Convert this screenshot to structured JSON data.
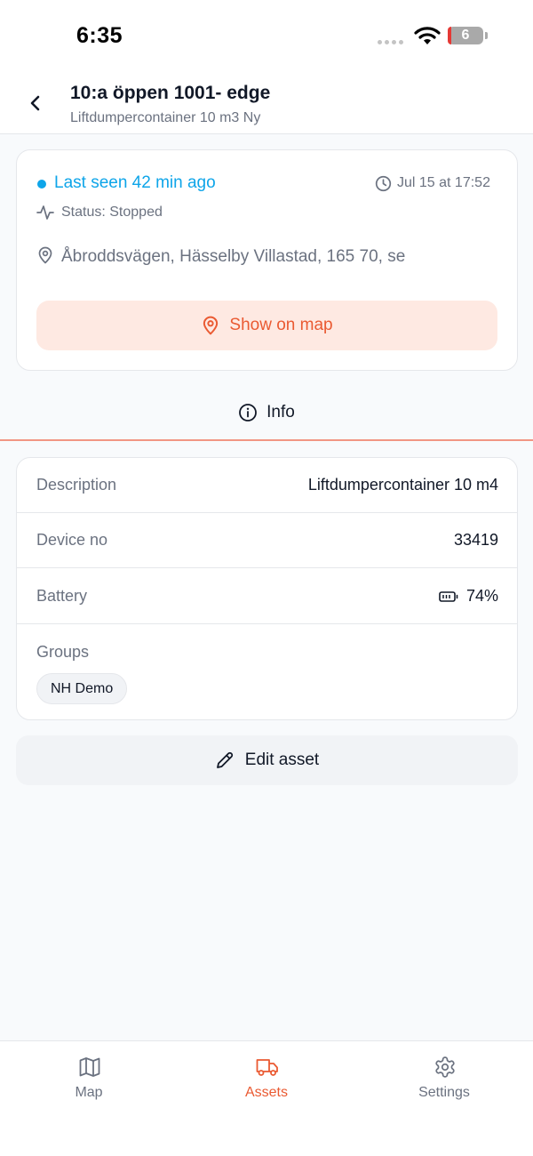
{
  "status_bar": {
    "time": "6:35",
    "battery_level": "6",
    "wifi_icon": "wifi-icon",
    "signal_icon": "cellular-signal-icon"
  },
  "header": {
    "back_icon": "chevron-left-icon",
    "title": "10:a öppen 1001- edge",
    "subtitle": "Liftdumpercontainer 10 m3 Ny"
  },
  "status_card": {
    "last_seen": "Last seen 42 min ago",
    "timestamp": "Jul 15 at 17:52",
    "status": "Status: Stopped",
    "address": "Åbroddsvägen, Hässelby Villastad, 165 70, se",
    "show_on_map_label": "Show on map"
  },
  "tabs": [
    {
      "label": "Info",
      "icon": "info-icon",
      "active": true
    }
  ],
  "info": {
    "rows": [
      {
        "label": "Description",
        "value": "Liftdumpercontainer 10 m4"
      },
      {
        "label": "Device no",
        "value": "33419"
      },
      {
        "label": "Battery",
        "value": "74%"
      }
    ],
    "groups_label": "Groups",
    "groups": [
      "NH Demo"
    ]
  },
  "edit_button_label": "Edit asset",
  "bottom_nav": [
    {
      "label": "Map",
      "icon": "map-icon",
      "active": false
    },
    {
      "label": "Assets",
      "icon": "truck-icon",
      "active": true
    },
    {
      "label": "Settings",
      "icon": "gear-icon",
      "active": false
    }
  ],
  "colors": {
    "accent": "#ea5a32",
    "accent_bg": "#fee9e2",
    "online": "#0ea5e9",
    "tab_underline": "#f19684",
    "muted_text": "#6b7280"
  }
}
